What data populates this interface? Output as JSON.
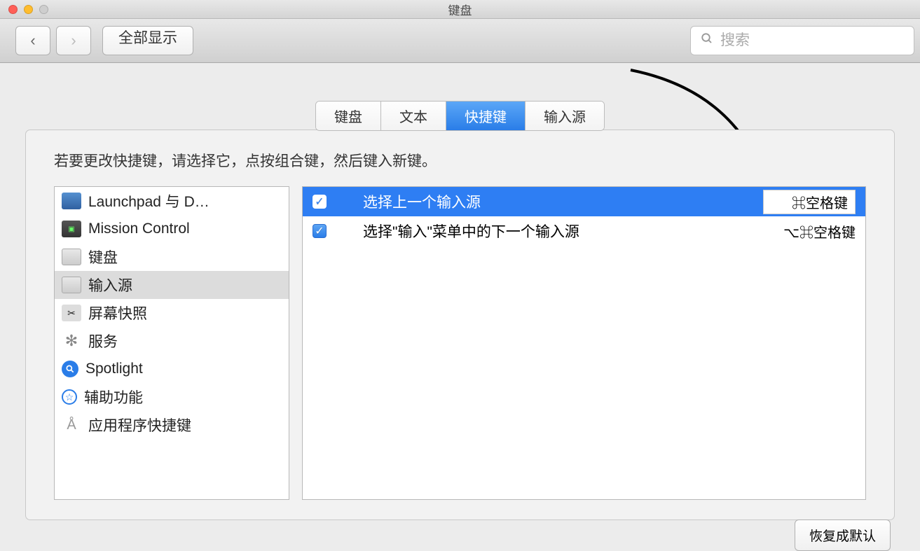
{
  "window": {
    "title": "键盘"
  },
  "toolbar": {
    "back_label": "‹",
    "forward_label": "›",
    "show_all_label": "全部显示",
    "search_placeholder": "搜索"
  },
  "tabs": {
    "items": [
      "键盘",
      "文本",
      "快捷键",
      "输入源"
    ],
    "active_index": 2
  },
  "panel": {
    "instruction": "若要更改快捷键，请选择它，点按组合键，然后键入新键。",
    "restore_label": "恢复成默认"
  },
  "categories": [
    {
      "label": "Launchpad 与 D…",
      "icon": "launchpad-icon"
    },
    {
      "label": "Mission Control",
      "icon": "mission-control-icon"
    },
    {
      "label": "键盘",
      "icon": "keyboard-icon"
    },
    {
      "label": "输入源",
      "icon": "input-sources-icon",
      "selected": true
    },
    {
      "label": "屏幕快照",
      "icon": "screenshot-icon"
    },
    {
      "label": "服务",
      "icon": "services-icon"
    },
    {
      "label": "Spotlight",
      "icon": "spotlight-icon"
    },
    {
      "label": "辅助功能",
      "icon": "accessibility-icon"
    },
    {
      "label": "应用程序快捷键",
      "icon": "app-shortcuts-icon"
    }
  ],
  "shortcuts": [
    {
      "checked": true,
      "label": "选择上一个输入源",
      "key": "⌘空格键",
      "selected": true,
      "editing": true
    },
    {
      "checked": true,
      "label": "选择\"输入\"菜单中的下一个输入源",
      "key": "⌥⌘空格键",
      "selected": false,
      "editing": false
    }
  ]
}
